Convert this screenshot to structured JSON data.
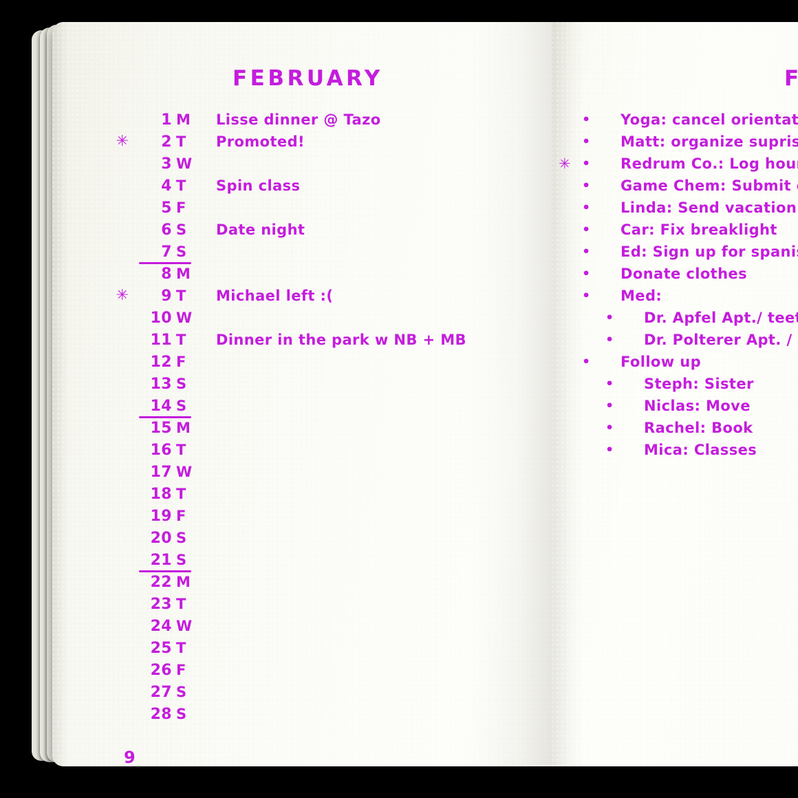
{
  "notebook": {
    "ink_color": "#c41ddd",
    "paper_color": "#fbfbf6",
    "background_color": "#000000"
  },
  "left_page": {
    "title": "FEBRUARY",
    "page_number": "9",
    "columns": [
      "marker",
      "day",
      "weekday",
      "event"
    ],
    "days": [
      {
        "marker": "",
        "day": "1",
        "dow": "M",
        "event": "Lisse dinner @ Tazo",
        "week_end": false
      },
      {
        "marker": "*",
        "day": "2",
        "dow": "T",
        "event": "Promoted!",
        "week_end": false
      },
      {
        "marker": "",
        "day": "3",
        "dow": "W",
        "event": "",
        "week_end": false
      },
      {
        "marker": "",
        "day": "4",
        "dow": "T",
        "event": "Spin class",
        "week_end": false
      },
      {
        "marker": "",
        "day": "5",
        "dow": "F",
        "event": "",
        "week_end": false
      },
      {
        "marker": "",
        "day": "6",
        "dow": "S",
        "event": "Date night",
        "week_end": false
      },
      {
        "marker": "",
        "day": "7",
        "dow": "S",
        "event": "",
        "week_end": true
      },
      {
        "marker": "",
        "day": "8",
        "dow": "M",
        "event": "",
        "week_end": false
      },
      {
        "marker": "*",
        "day": "9",
        "dow": "T",
        "event": "Michael left :(",
        "week_end": false
      },
      {
        "marker": "",
        "day": "10",
        "dow": "W",
        "event": "",
        "week_end": false
      },
      {
        "marker": "",
        "day": "11",
        "dow": "T",
        "event": "Dinner in the park w NB + MB",
        "week_end": false
      },
      {
        "marker": "",
        "day": "12",
        "dow": "F",
        "event": "",
        "week_end": false
      },
      {
        "marker": "",
        "day": "13",
        "dow": "S",
        "event": "",
        "week_end": false
      },
      {
        "marker": "",
        "day": "14",
        "dow": "S",
        "event": "",
        "week_end": true
      },
      {
        "marker": "",
        "day": "15",
        "dow": "M",
        "event": "",
        "week_end": false
      },
      {
        "marker": "",
        "day": "16",
        "dow": "T",
        "event": "",
        "week_end": false
      },
      {
        "marker": "",
        "day": "17",
        "dow": "W",
        "event": "",
        "week_end": false
      },
      {
        "marker": "",
        "day": "18",
        "dow": "T",
        "event": "",
        "week_end": false
      },
      {
        "marker": "",
        "day": "19",
        "dow": "F",
        "event": "",
        "week_end": false
      },
      {
        "marker": "",
        "day": "20",
        "dow": "S",
        "event": "",
        "week_end": false
      },
      {
        "marker": "",
        "day": "21",
        "dow": "S",
        "event": "",
        "week_end": true
      },
      {
        "marker": "",
        "day": "22",
        "dow": "M",
        "event": "",
        "week_end": false
      },
      {
        "marker": "",
        "day": "23",
        "dow": "T",
        "event": "",
        "week_end": false
      },
      {
        "marker": "",
        "day": "24",
        "dow": "W",
        "event": "",
        "week_end": false
      },
      {
        "marker": "",
        "day": "25",
        "dow": "T",
        "event": "",
        "week_end": false
      },
      {
        "marker": "",
        "day": "26",
        "dow": "F",
        "event": "",
        "week_end": false
      },
      {
        "marker": "",
        "day": "27",
        "dow": "S",
        "event": "",
        "week_end": false
      },
      {
        "marker": "",
        "day": "28",
        "dow": "S",
        "event": "",
        "week_end": false
      }
    ]
  },
  "right_page": {
    "title": "FEBRUARY",
    "title_visible": "FEBRU",
    "bullet_glyph": "•",
    "star_glyph": "✳",
    "todos": [
      {
        "marker": "",
        "level": 0,
        "text": "Yoga: cancel orientation"
      },
      {
        "marker": "",
        "level": 0,
        "text": "Matt: organize suprise party"
      },
      {
        "marker": "*",
        "level": 0,
        "text": "Redrum Co.: Log hours"
      },
      {
        "marker": "",
        "level": 0,
        "text": "Game Chem: Submit expenses"
      },
      {
        "marker": "",
        "level": 0,
        "text": "Linda: Send vacation photos"
      },
      {
        "marker": "",
        "level": 0,
        "text": "Car: Fix breaklight"
      },
      {
        "marker": "",
        "level": 0,
        "text": "Ed: Sign up for spanish class"
      },
      {
        "marker": "",
        "level": 0,
        "text": "Donate clothes"
      },
      {
        "marker": "",
        "level": 0,
        "text": "Med:"
      },
      {
        "marker": "",
        "level": 1,
        "text": "Dr. Apfel Apt./ teeth"
      },
      {
        "marker": "",
        "level": 1,
        "text": "Dr. Polterer Apt. / general"
      },
      {
        "marker": "",
        "level": 0,
        "text": "Follow up"
      },
      {
        "marker": "",
        "level": 1,
        "text": "Steph: Sister"
      },
      {
        "marker": "",
        "level": 1,
        "text": "Niclas: Move"
      },
      {
        "marker": "",
        "level": 1,
        "text": "Rachel: Book"
      },
      {
        "marker": "",
        "level": 1,
        "text": "Mica: Classes"
      }
    ]
  }
}
